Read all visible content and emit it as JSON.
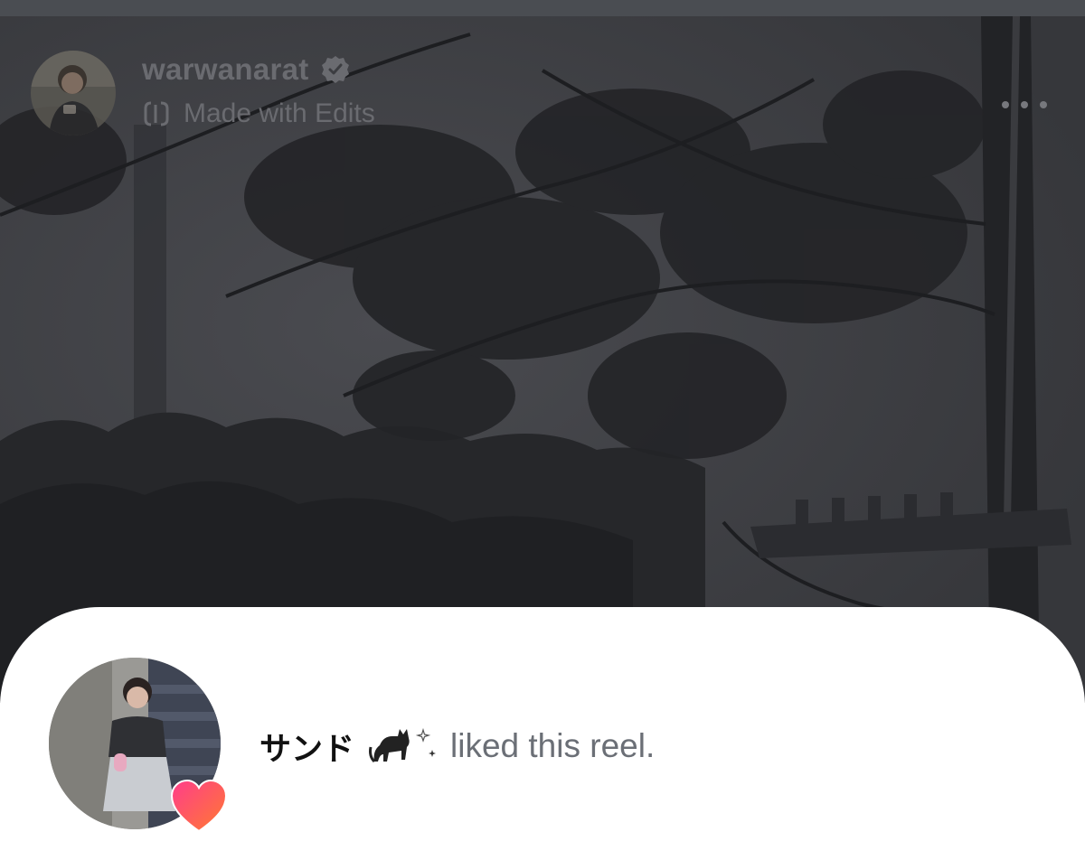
{
  "reel": {
    "username": "warwanarat",
    "verified": true,
    "subtitle": "Made with Edits",
    "icons": {
      "verified": "verified-badge-icon",
      "edits": "edits-app-icon",
      "more": "more-options-icon"
    }
  },
  "notification": {
    "liker_name": "サンド",
    "decorations": [
      "black-cat-icon",
      "sparkle-icon"
    ],
    "action_text": "liked this reel.",
    "badge_icon": "heart-icon"
  },
  "colors": {
    "header_text": "#6a6b70",
    "action_text": "#6b6f76",
    "name_text": "#111111",
    "heart_gradient_start": "#ff3d8b",
    "heart_gradient_end": "#ff7a30"
  }
}
